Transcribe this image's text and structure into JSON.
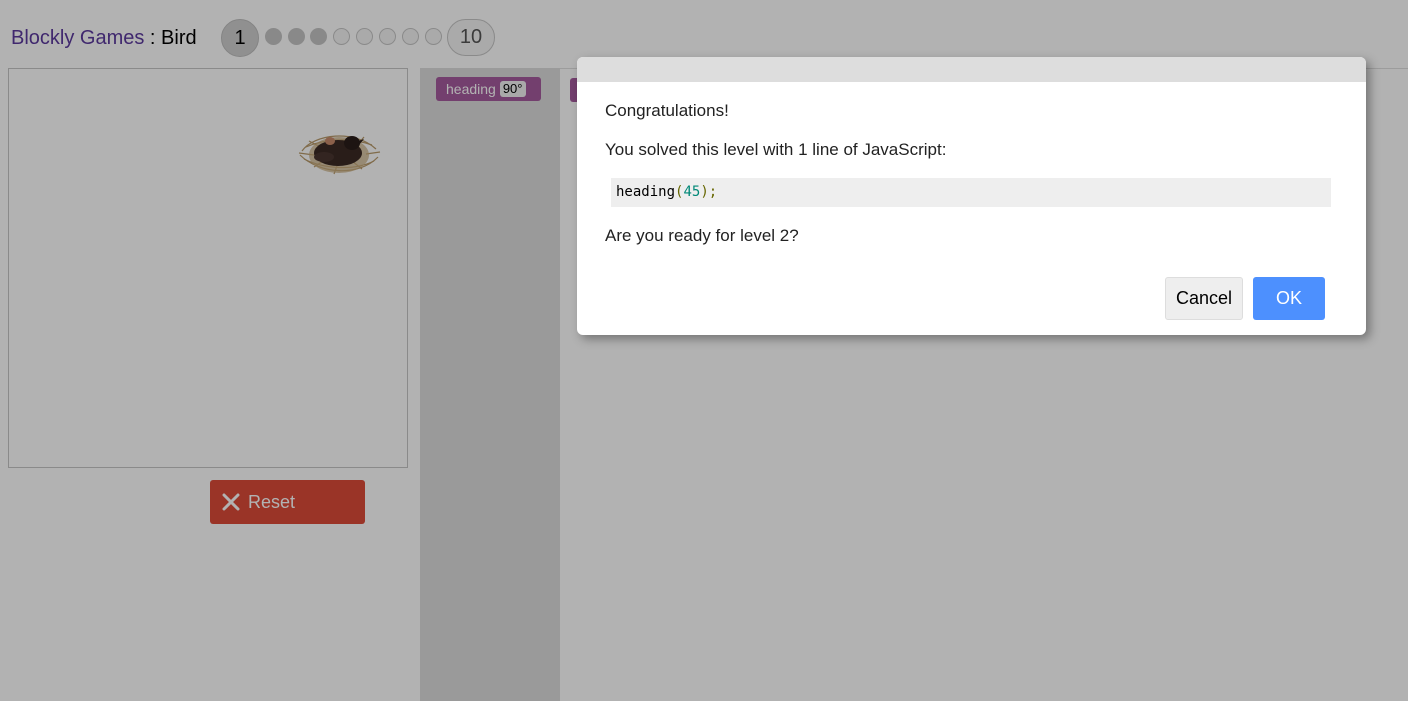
{
  "header": {
    "games_link": "Blockly Games",
    "separator": " : ",
    "game_name": "Bird",
    "levels": {
      "current": "1",
      "last": "10",
      "total": 10,
      "solved_count": 3
    }
  },
  "visualization": {
    "nest_icon": "bird-nest-icon"
  },
  "controls": {
    "reset_label": "Reset",
    "reset_icon": "close-x-icon"
  },
  "toolbox": {
    "block_label": "heading",
    "block_value": "90°"
  },
  "dialog": {
    "congrats": "Congratulations!",
    "message": "You solved this level with 1 line of JavaScript:",
    "code_func": "heading",
    "code_open": "(",
    "code_num": "45",
    "code_close": ");",
    "question": "Are you ready for level 2?",
    "cancel_label": "Cancel",
    "ok_label": "OK"
  },
  "colors": {
    "reset_button": "#dd4b39",
    "ok_button": "#4d90fe",
    "block": "#a55b9e",
    "link": "#5c3a9e"
  }
}
